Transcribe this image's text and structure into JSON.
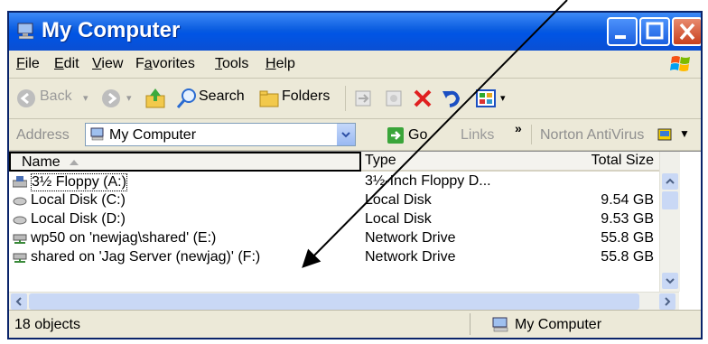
{
  "window": {
    "title": "My Computer"
  },
  "menubar": {
    "items": [
      {
        "label": "File",
        "key": "F",
        "rest": "ile"
      },
      {
        "label": "Edit",
        "key": "E",
        "rest": "dit"
      },
      {
        "label": "View",
        "key": "V",
        "rest": "iew"
      },
      {
        "label": "Favorites",
        "pre": "F",
        "key": "a",
        "rest": "vorites"
      },
      {
        "label": "Tools",
        "key": "T",
        "rest": "ools"
      },
      {
        "label": "Help",
        "key": "H",
        "rest": "elp"
      }
    ]
  },
  "toolbar": {
    "back": "Back",
    "search": "Search",
    "folders": "Folders"
  },
  "address": {
    "label": "Address",
    "value": "My Computer",
    "go": "Go",
    "links": "Links",
    "links_chevron": "»",
    "norton": "Norton AntiVirus"
  },
  "columns": {
    "name": "Name",
    "type": "Type",
    "size": "Total Size"
  },
  "rows": [
    {
      "name": "3½ Floppy (A:)",
      "type": "3½-Inch Floppy D...",
      "size": ""
    },
    {
      "name": "Local Disk (C:)",
      "type": "Local Disk",
      "size": "9.54 GB"
    },
    {
      "name": "Local Disk (D:)",
      "type": "Local Disk",
      "size": "9.53 GB"
    },
    {
      "name": "wp50 on 'newjag\\shared' (E:)",
      "type": "Network Drive",
      "size": "55.8 GB"
    },
    {
      "name": "shared on 'Jag Server (newjag)' (F:)",
      "type": "Network Drive",
      "size": "55.8 GB"
    }
  ],
  "status": {
    "count": "18 objects",
    "location": "My Computer"
  },
  "colors": {
    "titlebar": "#0055e5",
    "chrome": "#ece9d8",
    "close": "#c8401e",
    "selection_border": "#000000",
    "arrow": "#000000"
  }
}
